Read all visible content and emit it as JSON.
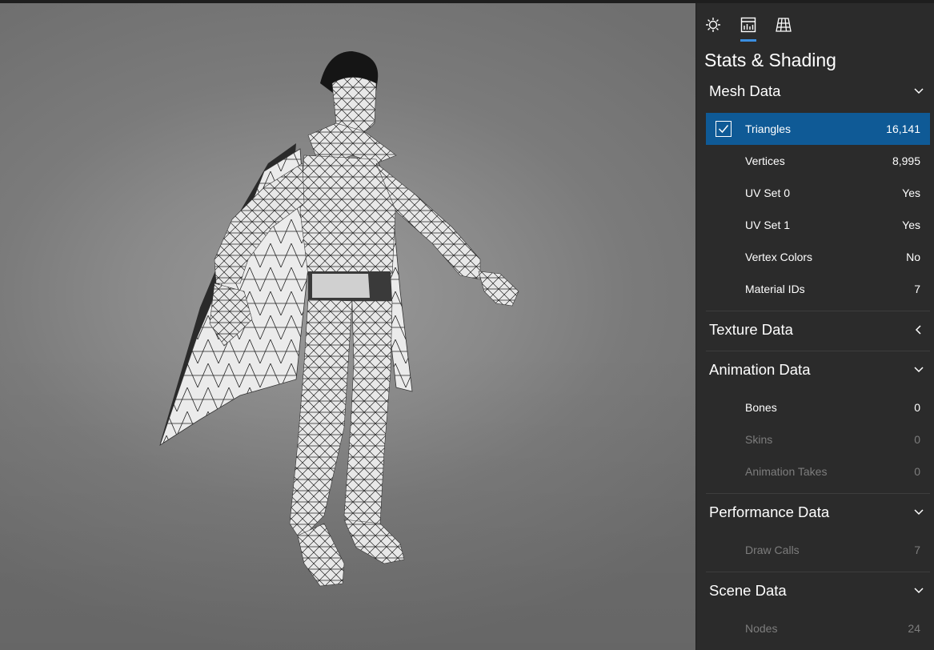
{
  "panel": {
    "title": "Stats & Shading",
    "tabs": [
      {
        "icon": "sun-icon",
        "active": false
      },
      {
        "icon": "stats-icon",
        "active": true
      },
      {
        "icon": "grid-icon",
        "active": false
      }
    ]
  },
  "sections": {
    "mesh": {
      "title": "Mesh Data",
      "expanded": true,
      "rows": [
        {
          "label": "Triangles",
          "value": "16,141"
        },
        {
          "label": "Vertices",
          "value": "8,995"
        },
        {
          "label": "UV Set 0",
          "value": "Yes"
        },
        {
          "label": "UV Set 1",
          "value": "Yes"
        },
        {
          "label": "Vertex Colors",
          "value": "No"
        },
        {
          "label": "Material IDs",
          "value": "7"
        }
      ]
    },
    "texture": {
      "title": "Texture Data",
      "expanded": false
    },
    "animation": {
      "title": "Animation Data",
      "expanded": true,
      "rows": [
        {
          "label": "Bones",
          "value": "0"
        },
        {
          "label": "Skins",
          "value": "0"
        },
        {
          "label": "Animation Takes",
          "value": "0"
        }
      ]
    },
    "performance": {
      "title": "Performance Data",
      "expanded": true,
      "rows": [
        {
          "label": "Draw Calls",
          "value": "7"
        }
      ]
    },
    "scene": {
      "title": "Scene Data",
      "expanded": true,
      "rows": [
        {
          "label": "Nodes",
          "value": "24"
        }
      ]
    }
  },
  "colors": {
    "accent": "#3b8ee0",
    "selected_row": "#0f5a96",
    "panel_bg": "#2b2b2b",
    "dim_text": "#7d7d7d"
  }
}
